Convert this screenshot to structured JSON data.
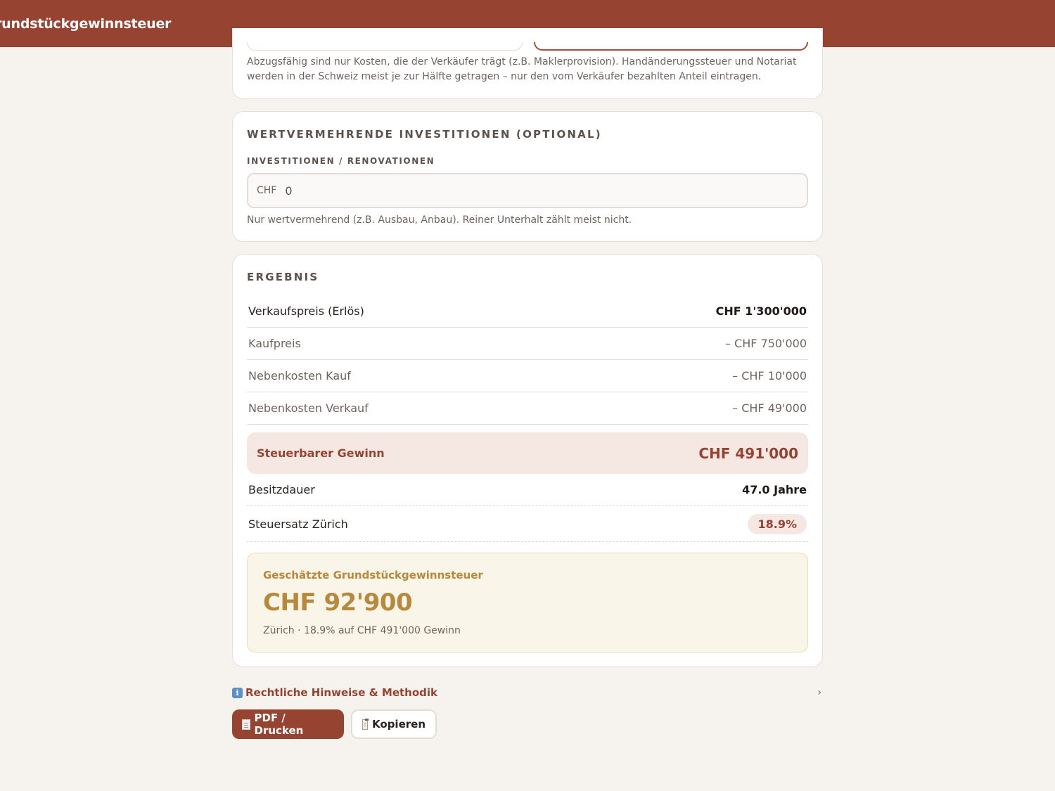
{
  "header": {
    "title": "rundstückgewinnsteuer"
  },
  "costs_card": {
    "hint": "Abzugsfähig sind nur Kosten, die der Verkäufer trägt (z.B. Maklerprovision). Handänderungssteuer und Notariat werden in der Schweiz meist je zur Hälfte getragen – nur den vom Verkäufer bezahlten Anteil eintragen."
  },
  "investments_card": {
    "title": "WERTVERMEHRENDE INVESTITIONEN (OPTIONAL)",
    "field_label": "INVESTITIONEN / RENOVATIONEN",
    "currency": "CHF",
    "value": "0",
    "hint": "Nur wertvermehrend (z.B. Ausbau, Anbau). Reiner Unterhalt zählt meist nicht."
  },
  "result": {
    "title": "ERGEBNIS",
    "rows": [
      {
        "label": "Verkaufspreis (Erlös)",
        "value": "CHF 1'300'000"
      },
      {
        "label": "Kaufpreis",
        "value": "– CHF 750'000"
      },
      {
        "label": "Nebenkosten Kauf",
        "value": "– CHF 10'000"
      },
      {
        "label": "Nebenkosten Verkauf",
        "value": "– CHF 49'000"
      }
    ],
    "gain": {
      "label": "Steuerbarer Gewinn",
      "value": "CHF 491'000"
    },
    "duration": {
      "label": "Besitzdauer",
      "value": "47.0 Jahre"
    },
    "rate": {
      "label": "Steuersatz Zürich",
      "value": "18.9%"
    },
    "tax": {
      "caption": "Geschätzte Grundstückgewinnsteuer",
      "amount": "CHF 92'900",
      "detail": "Zürich · 18.9% auf CHF 491'000 Gewinn"
    }
  },
  "legal": {
    "label": "Rechtliche Hinweise & Methodik",
    "chevron": "›"
  },
  "actions": {
    "pdf_label": "PDF / Drucken",
    "copy_label": "Kopieren"
  },
  "colors": {
    "brand": "#974331",
    "gold": "#b8893a",
    "background": "#f6f2ee"
  }
}
